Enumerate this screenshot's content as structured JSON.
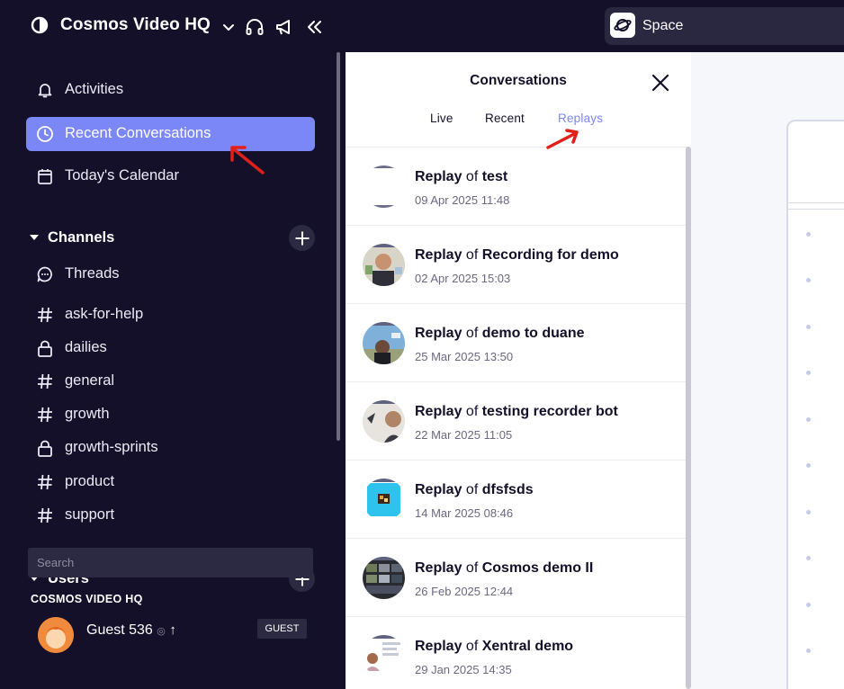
{
  "workspace": {
    "name": "Cosmos Video HQ",
    "space_search_label": "Space"
  },
  "sidebar": {
    "nav": [
      {
        "label": "Activities",
        "icon": "bell-icon"
      },
      {
        "label": "Recent Conversations",
        "icon": "clock-icon",
        "active": true
      },
      {
        "label": "Today's Calendar",
        "icon": "calendar-icon"
      }
    ],
    "channels_heading": "Channels",
    "channels": [
      {
        "label": "Threads",
        "icon": "chat-bubble-icon"
      },
      {
        "label": "ask-for-help",
        "icon": "hash-icon"
      },
      {
        "label": "dailies",
        "icon": "lock-icon"
      },
      {
        "label": "general",
        "icon": "hash-icon"
      },
      {
        "label": "growth",
        "icon": "hash-icon"
      },
      {
        "label": "growth-sprints",
        "icon": "lock-icon"
      },
      {
        "label": "product",
        "icon": "hash-icon"
      },
      {
        "label": "support",
        "icon": "hash-icon"
      }
    ],
    "users_heading": "Users",
    "user_search_placeholder": "Search",
    "org_label": "COSMOS VIDEO HQ",
    "guest": {
      "name": "Guest 536",
      "badge": "GUEST"
    }
  },
  "conversations": {
    "title": "Conversations",
    "tabs": [
      {
        "label": "Live"
      },
      {
        "label": "Recent"
      },
      {
        "label": "Replays",
        "active": true
      }
    ],
    "items": [
      {
        "prefix": "Replay",
        "of": "of",
        "name": "test",
        "date": "09 Apr 2025 11:48"
      },
      {
        "prefix": "Replay",
        "of": "of",
        "name": "Recording for demo",
        "date": "02 Apr 2025 15:03"
      },
      {
        "prefix": "Replay",
        "of": "of",
        "name": "demo to duane",
        "date": "25 Mar 2025 13:50"
      },
      {
        "prefix": "Replay",
        "of": "of",
        "name": "testing recorder bot",
        "date": "22 Mar 2025 11:05"
      },
      {
        "prefix": "Replay",
        "of": "of",
        "name": "dfsfsds",
        "date": "14 Mar 2025 08:46"
      },
      {
        "prefix": "Replay",
        "of": "of",
        "name": "Cosmos demo II",
        "date": "26 Feb 2025 12:44"
      },
      {
        "prefix": "Replay",
        "of": "of",
        "name": "Xentral demo",
        "date": "29 Jan 2025 14:35"
      }
    ]
  },
  "colors": {
    "sidebar_bg": "#141029",
    "accent": "#7b86f7",
    "annotation_red": "#e0201b"
  }
}
